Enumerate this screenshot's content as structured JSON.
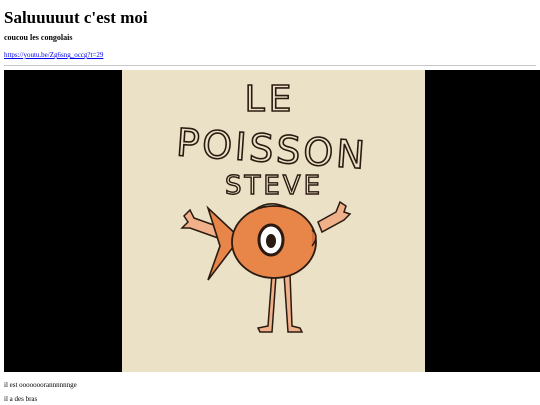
{
  "page": {
    "title": "Saluuuuut c'est moi",
    "subtitle": "coucou les congolais",
    "link_text": "https://youtu.be/Zg6sng_occg?t=29"
  },
  "video": {
    "thumbnail_lines": [
      "LE",
      "POISSON",
      "STEVE"
    ],
    "colors": {
      "letterbox": "#000000",
      "background": "#ebe1c6",
      "fish": "#e8864a",
      "outline": "#2a1a10",
      "legs": "#f0b08a"
    }
  },
  "paragraphs": [
    "il est ooooooorannnnnnge",
    "il a des bras"
  ]
}
